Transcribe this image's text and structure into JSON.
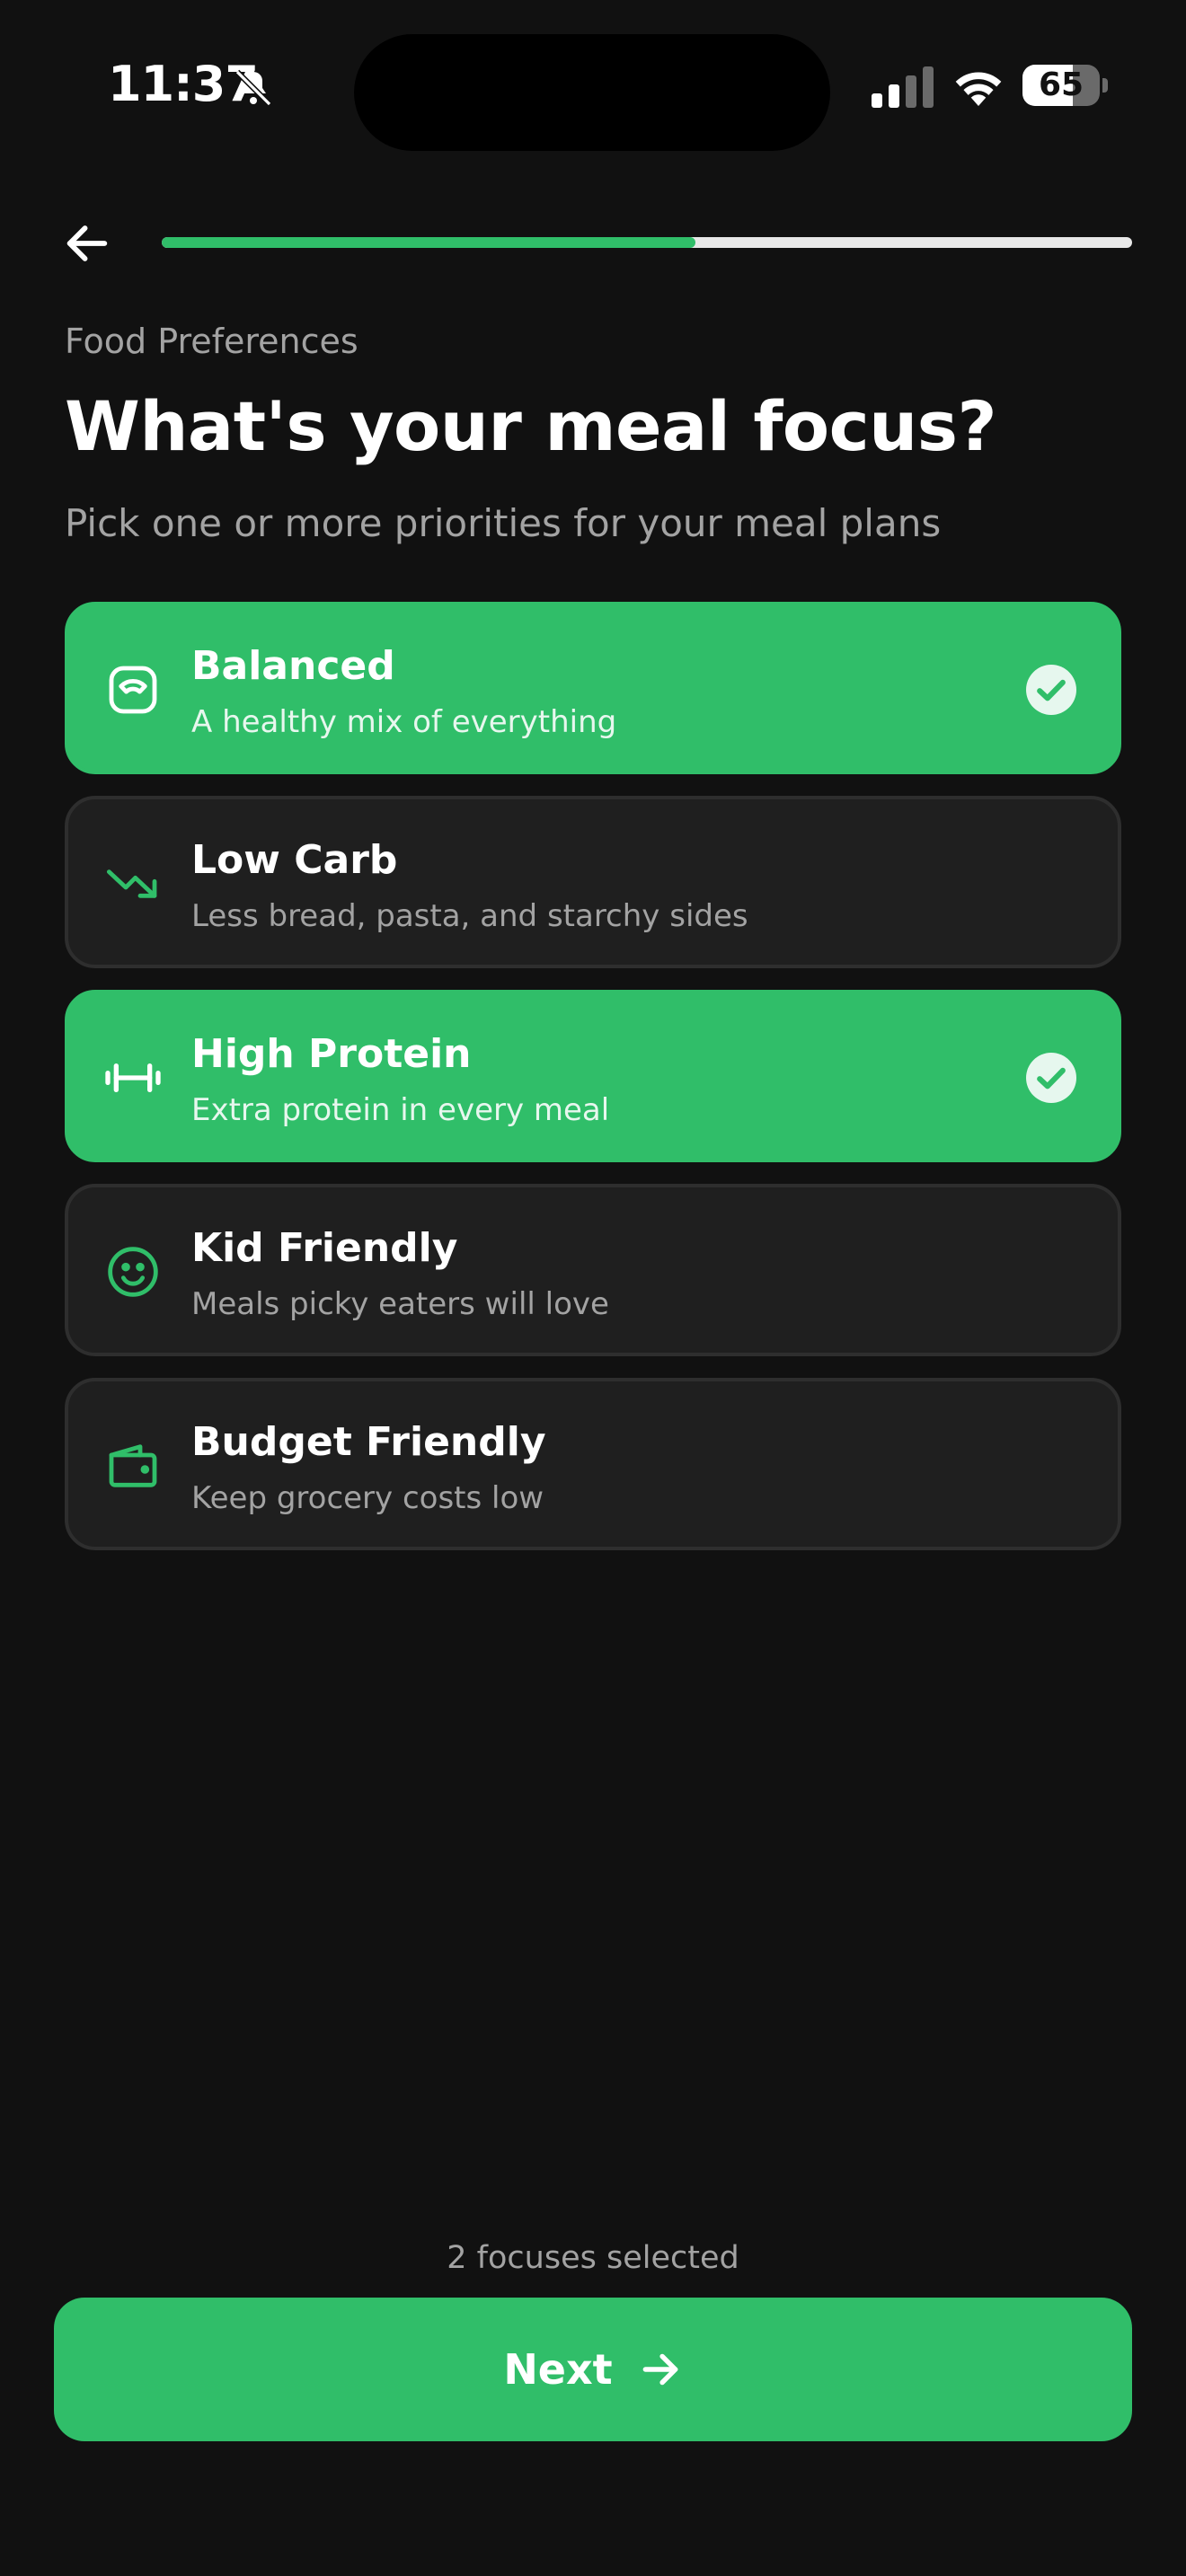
{
  "status_bar": {
    "time": "11:37",
    "battery": "65",
    "icons": [
      "bell-slash-icon",
      "signal-icon",
      "wifi-icon",
      "battery-icon"
    ]
  },
  "header": {
    "back_icon": "arrow-left-icon",
    "progress": 0.55
  },
  "content": {
    "eyebrow": "Food Preferences",
    "title": "What's your meal focus?",
    "subtitle": "Pick one or more priorities for your meal plans"
  },
  "options": [
    {
      "label": "Balanced",
      "description": "A healthy mix of everything",
      "icon": "scale-icon",
      "selected": true
    },
    {
      "label": "Low Carb",
      "description": "Less bread, pasta, and starchy sides",
      "icon": "trending-down-icon",
      "selected": false
    },
    {
      "label": "High Protein",
      "description": "Extra protein in every meal",
      "icon": "dumbbell-icon",
      "selected": true
    },
    {
      "label": "Kid Friendly",
      "description": "Meals picky eaters will love",
      "icon": "smile-icon",
      "selected": false
    },
    {
      "label": "Budget Friendly",
      "description": "Keep grocery costs low",
      "icon": "wallet-icon",
      "selected": false
    }
  ],
  "footer": {
    "selection_count": "2 focuses selected",
    "next_label": "Next",
    "next_icon": "arrow-right-icon"
  },
  "colors": {
    "background": "#111111",
    "accent": "#30be69",
    "card": "#1f1f1f",
    "card_border": "#2e2e2e",
    "muted_text": "#a3a3a3"
  }
}
